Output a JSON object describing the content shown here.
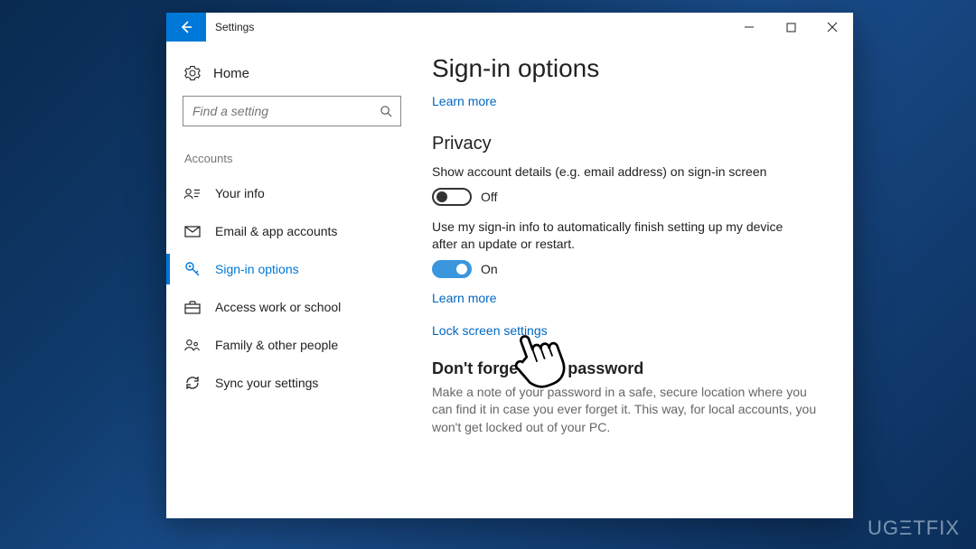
{
  "titlebar": {
    "title": "Settings"
  },
  "sidebar": {
    "home_label": "Home",
    "search_placeholder": "Find a setting",
    "category": "Accounts",
    "items": [
      {
        "label": "Your info"
      },
      {
        "label": "Email & app accounts"
      },
      {
        "label": "Sign-in options"
      },
      {
        "label": "Access work or school"
      },
      {
        "label": "Family & other people"
      },
      {
        "label": "Sync your settings"
      }
    ]
  },
  "content": {
    "page_title": "Sign-in options",
    "learn_more": "Learn more",
    "privacy": {
      "heading": "Privacy",
      "show_details_desc": "Show account details (e.g. email address) on sign-in screen",
      "show_details_state": "Off",
      "use_signin_desc": "Use my sign-in info to automatically finish setting up my device after an update or restart.",
      "use_signin_state": "On",
      "learn_more": "Learn more",
      "lock_screen": "Lock screen settings"
    },
    "password_reminder": {
      "heading": "Don't forget your password",
      "body": "Make a note of your password in a safe, secure location where you can find it in case you ever forget it. This way, for local accounts, you won't get locked out of your PC."
    }
  },
  "watermark": "UGΞTFIX"
}
